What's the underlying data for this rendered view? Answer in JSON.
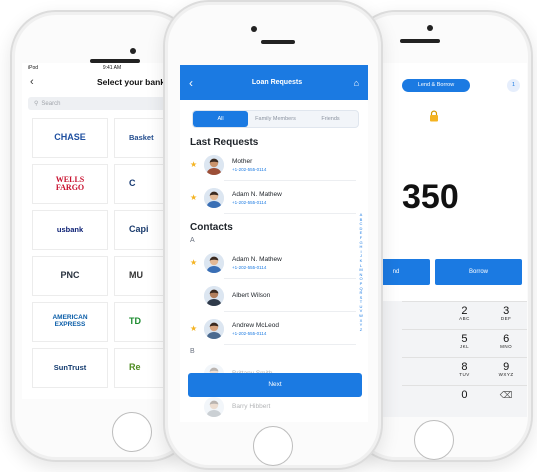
{
  "left_screen": {
    "status": {
      "carrier": "iPod",
      "time": "9:41 AM"
    },
    "title": "Select your bank",
    "search_placeholder": "Search",
    "banks": [
      {
        "label": "CHASE",
        "color": "#1e4fa0"
      },
      {
        "label": "Basket",
        "color": "#244e8f"
      },
      {
        "label": "WELLS\nFARGO",
        "color": "#c8102e"
      },
      {
        "label": "C",
        "color": "#173a72"
      },
      {
        "label": "usbank",
        "color": "#0c2074"
      },
      {
        "label": "Capi",
        "color": "#1a3b6d"
      },
      {
        "label": "PNC",
        "color": "#27303d"
      },
      {
        "label": "MU",
        "color": "#333333"
      },
      {
        "label": "AMERICAN\nEXPRESS",
        "color": "#0a5da8"
      },
      {
        "label": "TD",
        "color": "#1a8b2e"
      },
      {
        "label": "SunTrust",
        "color": "#123a6e"
      },
      {
        "label": "Re",
        "color": "#4d8a1f"
      }
    ]
  },
  "middle_screen": {
    "title": "Loan Requests",
    "tabs": [
      {
        "label": "All",
        "active": true
      },
      {
        "label": "Family Members",
        "active": false
      },
      {
        "label": "Friends",
        "active": false
      }
    ],
    "last_requests_heading": "Last Requests",
    "last_requests": [
      {
        "name": "Mother",
        "phone": "+1-202-555-0114",
        "starred": true
      },
      {
        "name": "Adam N. Mathew",
        "phone": "+1-202-555-0114",
        "starred": true
      }
    ],
    "contacts_heading": "Contacts",
    "section_a": "A",
    "contacts_a": [
      {
        "name": "Adam N. Mathew",
        "phone": "+1-202-555-0114",
        "starred": true
      },
      {
        "name": "Albert Wilson",
        "phone": "",
        "starred": false
      },
      {
        "name": "Andrew McLeod",
        "phone": "+1-202-555-0114",
        "starred": true
      }
    ],
    "section_b": "B",
    "contacts_b": [
      {
        "name": "Brittany Smith"
      },
      {
        "name": "Barry Hibbert"
      }
    ],
    "alphabet": [
      "A",
      "B",
      "C",
      "D",
      "E",
      "F",
      "G",
      "H",
      "I",
      "J",
      "K",
      "L",
      "M",
      "N",
      "O",
      "P",
      "Q",
      "R",
      "S",
      "T",
      "U",
      "V",
      "W",
      "X",
      "Y",
      "Z"
    ],
    "next_label": "Next"
  },
  "right_screen": {
    "top_tab": "Lend & Borrow",
    "badge": "1",
    "amount": "350",
    "lend_label": "nd",
    "borrow_label": "Borrow",
    "keys": [
      [
        {
          "d": "",
          "l": ""
        },
        {
          "d": "2",
          "l": "ABC"
        },
        {
          "d": "3",
          "l": "DEF"
        }
      ],
      [
        {
          "d": "",
          "l": ""
        },
        {
          "d": "5",
          "l": "JKL"
        },
        {
          "d": "6",
          "l": "MNO"
        }
      ],
      [
        {
          "d": "",
          "l": ""
        },
        {
          "d": "8",
          "l": "TUV"
        },
        {
          "d": "9",
          "l": "WXYZ"
        }
      ],
      [
        {
          "d": "",
          "l": ""
        },
        {
          "d": "0",
          "l": ""
        },
        {
          "d": "",
          "l": ""
        }
      ]
    ]
  },
  "colors": {
    "accent": "#1b7ae2",
    "star": "#f4b321"
  }
}
